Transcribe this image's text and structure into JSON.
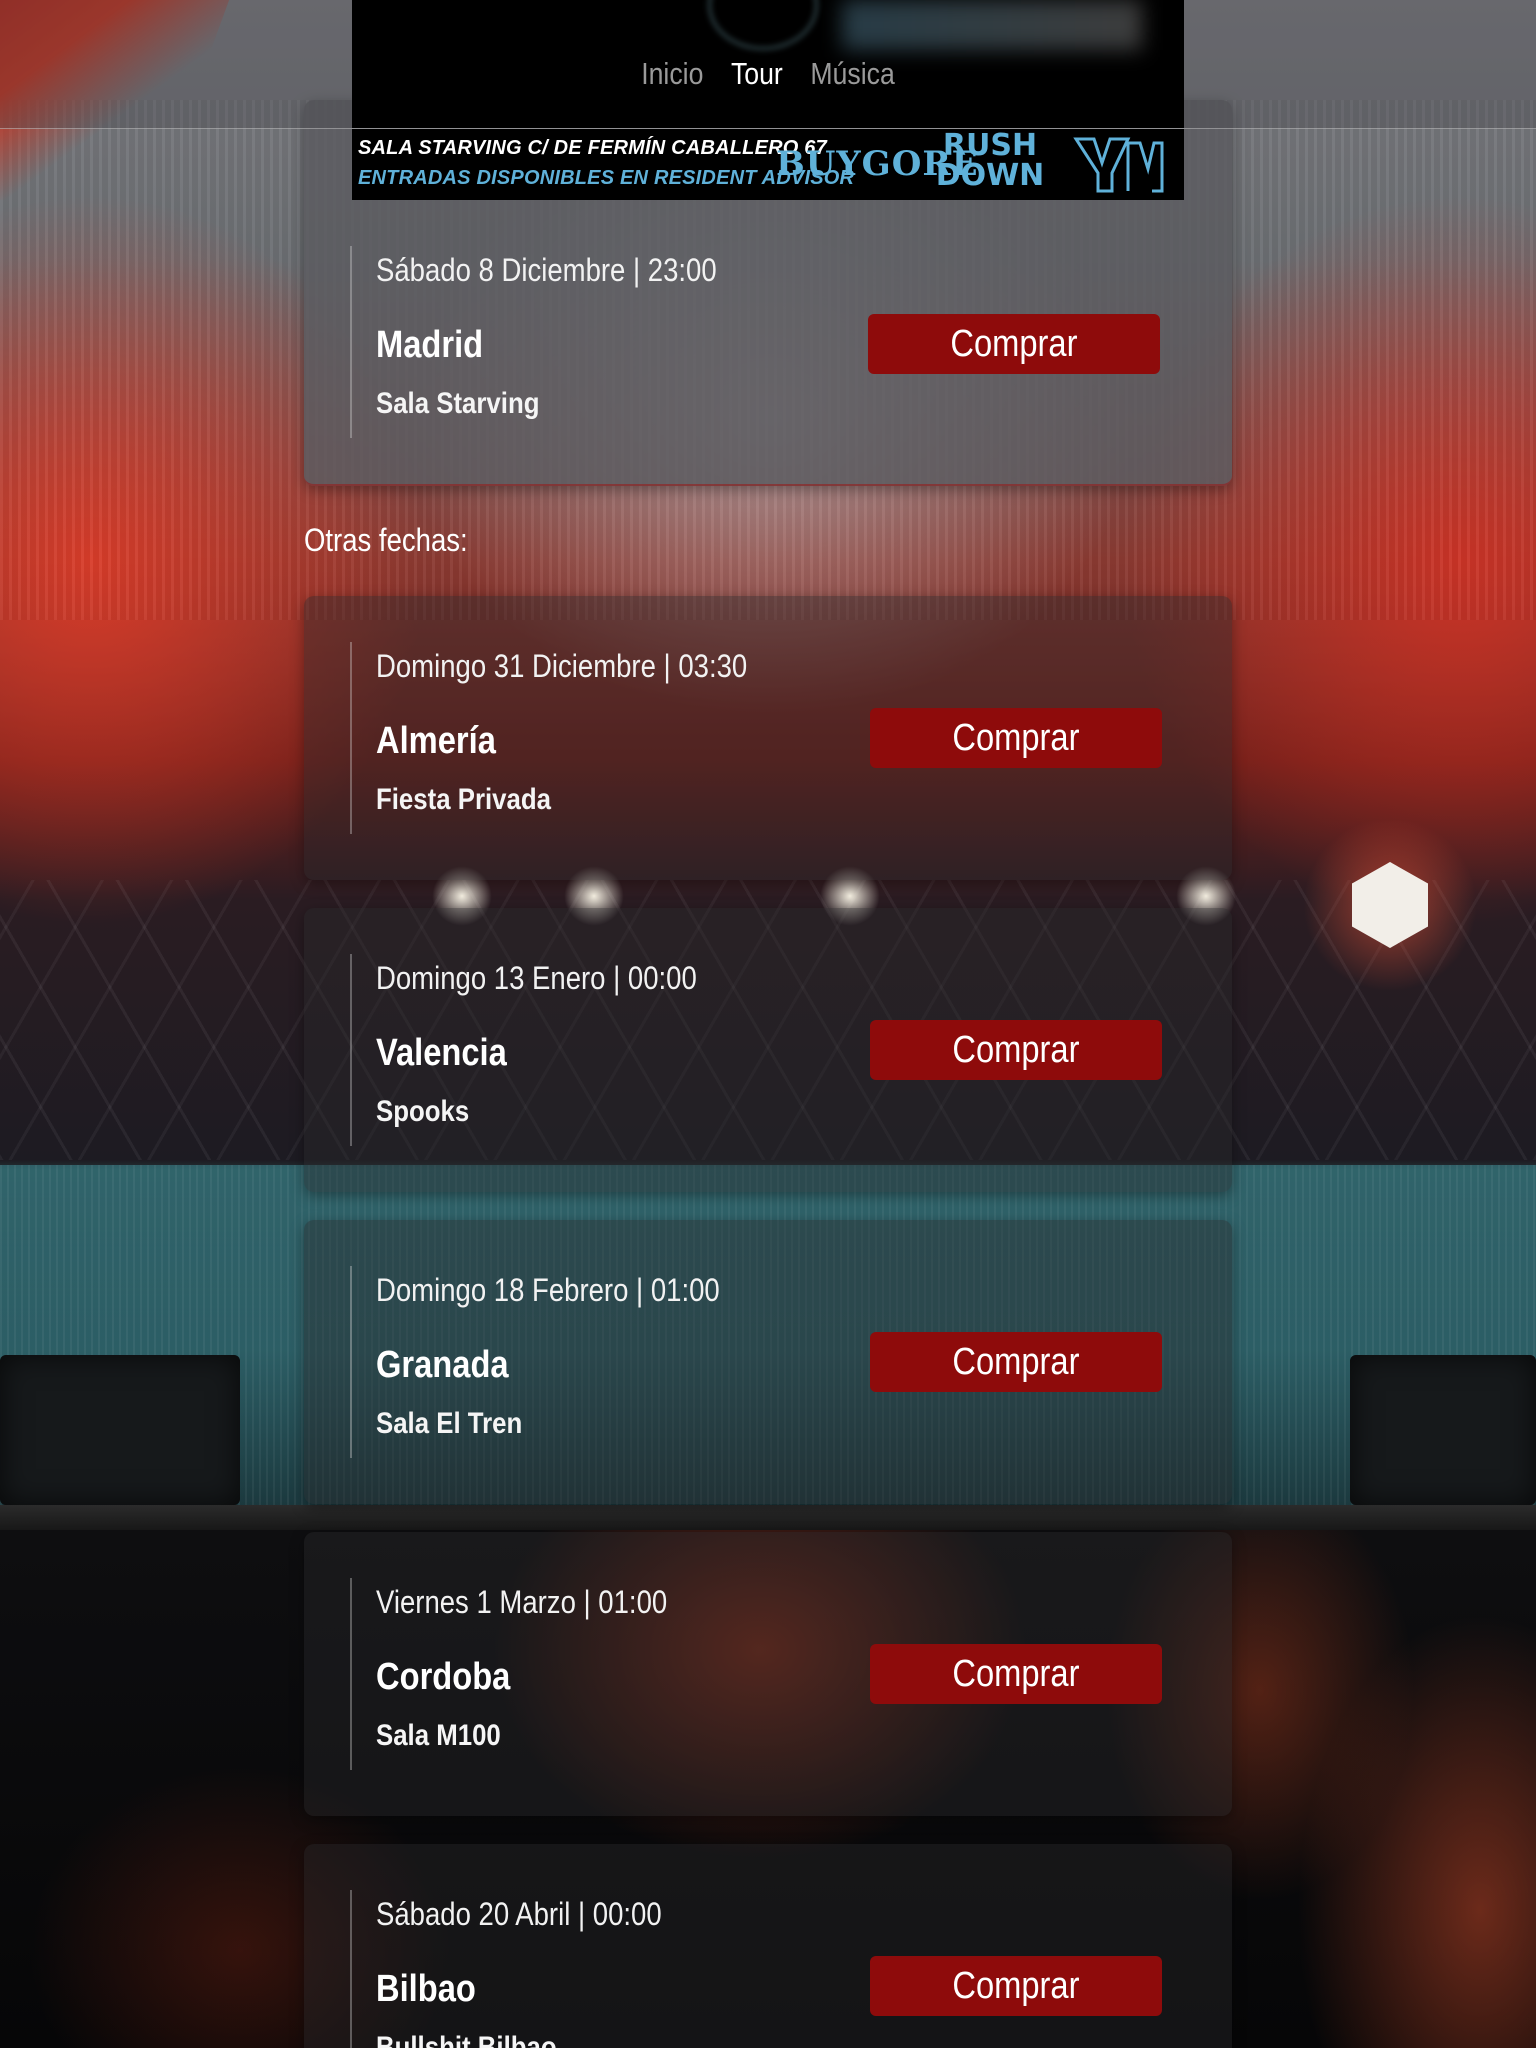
{
  "nav": {
    "items": [
      {
        "label": "Inicio",
        "active": false
      },
      {
        "label": "Tour",
        "active": true
      },
      {
        "label": "Música",
        "active": false
      }
    ]
  },
  "banner_strip": {
    "line1": "SALA STARVING   C/ DE FERMÍN CABALLERO 67",
    "line2": "ENTRADAS DISPONIBLES EN RESIDENT ADVISOR",
    "logo_buygore": "BUYGORE",
    "logo_rushdown_1": "RUSH",
    "logo_rushdown_2": "DOWN"
  },
  "featured_event": {
    "date": "Sábado 8 Diciembre | 23:00",
    "city": "Madrid",
    "venue": "Sala Starving",
    "button_label": "Comprar"
  },
  "other_dates_label": "Otras fechas:",
  "events": [
    {
      "date": "Domingo 31 Diciembre | 03:30",
      "city": "Almería",
      "venue": "Fiesta Privada",
      "button_label": "Comprar"
    },
    {
      "date": "Domingo 13 Enero | 00:00",
      "city": "Valencia",
      "venue": "Spooks",
      "button_label": "Comprar"
    },
    {
      "date": "Domingo 18 Febrero | 01:00",
      "city": "Granada",
      "venue": "Sala El Tren",
      "button_label": "Comprar"
    },
    {
      "date": "Viernes 1 Marzo | 01:00",
      "city": "Cordoba",
      "venue": "Sala M100",
      "button_label": "Comprar"
    },
    {
      "date": "Sábado 20 Abril | 00:00",
      "city": "Bilbao",
      "venue": "Bullshit Bilbao",
      "button_label": "Comprar"
    }
  ],
  "colors": {
    "accent_button": "#8e0b0b",
    "nav_active": "#ffffff",
    "nav_inactive": "#9a9a9a",
    "banner_blue": "#5fb1d9"
  }
}
